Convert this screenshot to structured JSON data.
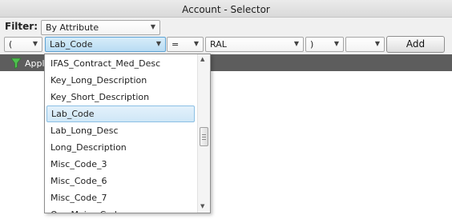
{
  "window": {
    "title": "Account - Selector"
  },
  "filter": {
    "label": "Filter:",
    "mode_value": "By Attribute"
  },
  "criteria": {
    "open_paren": "(",
    "attribute": "Lab_Code",
    "operator": "=",
    "value": "RAL",
    "close_paren": ")",
    "logic": "",
    "add_label": "Add"
  },
  "apply": {
    "label": "Appl"
  },
  "attribute_list": {
    "items": [
      "IFAS_Contract_Med_Desc",
      "Key_Long_Description",
      "Key_Short_Description",
      "Lab_Code",
      "Lab_Long_Desc",
      "Long_Description",
      "Misc_Code_3",
      "Misc_Code_6",
      "Misc_Code_7",
      "Org_Major_Code"
    ],
    "selected": "Lab_Code"
  }
}
